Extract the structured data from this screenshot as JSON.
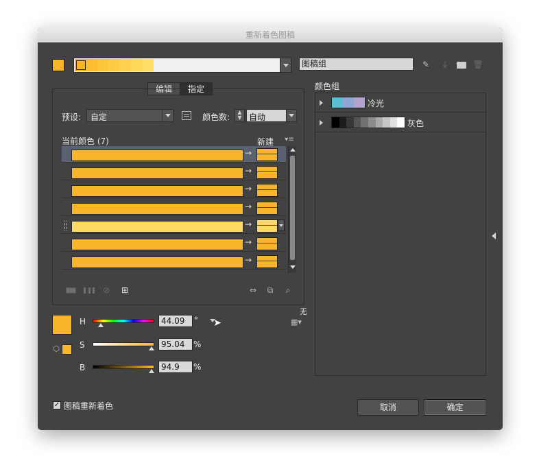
{
  "title": "重新着色图稿",
  "colors": {
    "primary": "#fbb52b",
    "light": "#ffd966",
    "row": "#ffc832"
  },
  "top": {
    "group_name": "图稿组",
    "strip_colors": [
      "#fbb52b",
      "#fcbd33",
      "#fdc53b",
      "#fdcc45",
      "#fed250",
      "#ffd95c",
      "#ffdf69"
    ]
  },
  "tabs": {
    "edit": "编辑",
    "assign": "指定"
  },
  "preset": {
    "label": "预设:",
    "value": "自定"
  },
  "color_count": {
    "label": "颜色数:",
    "value": "自动"
  },
  "current_colors": {
    "label": "当前颜色 (7)",
    "new_label": "新建",
    "rows": [
      "#fbb52b",
      "#fbb52b",
      "#fbb52b",
      "#fbb52b",
      "#ffd966",
      "#fbb52b",
      "#fbb52b"
    ]
  },
  "hsb": {
    "h_label": "H",
    "h_value": "44.09",
    "h_unit": "°",
    "s_label": "S",
    "s_value": "95.04",
    "s_unit": "%",
    "b_label": "B",
    "b_value": "94.9",
    "b_unit": "%"
  },
  "none_label": "无",
  "color_groups": {
    "title": "颜色组",
    "items": [
      {
        "name": "冷光",
        "swatches": [
          "#5bbfd1",
          "#8fa6d6",
          "#b2a4cf"
        ]
      },
      {
        "name": "灰色",
        "swatches": [
          "#000000",
          "#1c1c1c",
          "#383838",
          "#555555",
          "#717171",
          "#8d8d8d",
          "#aaaaaa",
          "#c6c6c6",
          "#e2e2e2",
          "#ffffff"
        ]
      }
    ]
  },
  "recolor_artwork_label": "图稿重新着色",
  "buttons": {
    "cancel": "取消",
    "ok": "确定"
  }
}
